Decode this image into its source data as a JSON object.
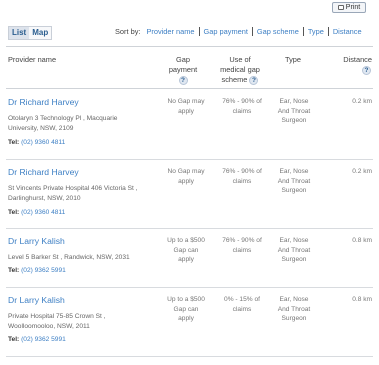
{
  "toolbar": {
    "print_label": "Print"
  },
  "view_toggle": {
    "list_label": "List",
    "map_label": "Map"
  },
  "sort": {
    "label": "Sort by:",
    "options": [
      "Provider name",
      "Gap payment",
      "Gap scheme",
      "Type",
      "Distance"
    ]
  },
  "table": {
    "headers": {
      "provider": "Provider name",
      "gap_payment": [
        "Gap",
        "payment"
      ],
      "medical_gap": [
        "Use of",
        "medical gap",
        "scheme"
      ],
      "type": "Type",
      "distance": "Distance"
    },
    "help_icon": "?",
    "tel_label": "Tel:",
    "rows": [
      {
        "name": "Dr Richard Harvey",
        "address": [
          "Otolaryn 3 Technology Pl , Macquarie",
          "University, NSW, 2109"
        ],
        "tel": "(02) 9360 4811",
        "gap": [
          "No Gap may",
          "apply"
        ],
        "scheme": [
          "76% - 90% of",
          "claims"
        ],
        "type": [
          "Ear, Nose",
          "And Throat",
          "Surgeon"
        ],
        "distance": "0.2 km"
      },
      {
        "name": "Dr Richard Harvey",
        "address": [
          "St Vincents Private Hospital 406 Victoria St ,",
          "Darlinghurst, NSW, 2010"
        ],
        "tel": "(02) 9360 4811",
        "gap": [
          "No Gap may",
          "apply"
        ],
        "scheme": [
          "76% - 90% of",
          "claims"
        ],
        "type": [
          "Ear, Nose",
          "And Throat",
          "Surgeon"
        ],
        "distance": "0.2 km"
      },
      {
        "name": "Dr Larry Kalish",
        "address": [
          "Level 5 Barker St , Randwick, NSW, 2031"
        ],
        "tel": "(02) 9362 5991",
        "gap": [
          "Up to a $500",
          "Gap can",
          "apply"
        ],
        "scheme": [
          "76% - 90% of",
          "claims"
        ],
        "type": [
          "Ear, Nose",
          "And Throat",
          "Surgeon"
        ],
        "distance": "0.8 km"
      },
      {
        "name": "Dr Larry Kalish",
        "address": [
          "Private Hospital 75-85 Crown St ,",
          "Woolloomooloo, NSW, 2011"
        ],
        "tel": "(02) 9362 5991",
        "gap": [
          "Up to a $500",
          "Gap can",
          "apply"
        ],
        "scheme": [
          "0% - 15% of",
          "claims"
        ],
        "type": [
          "Ear, Nose",
          "And Throat",
          "Surgeon"
        ],
        "distance": "0.8 km"
      }
    ]
  }
}
